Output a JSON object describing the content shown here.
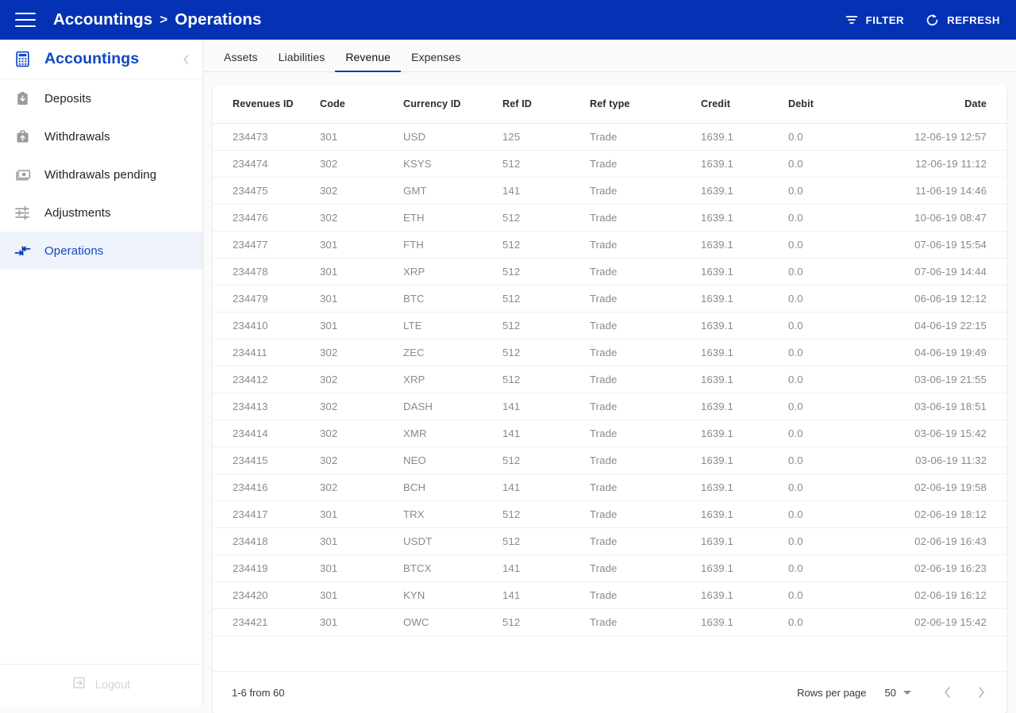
{
  "appbar": {
    "menu_icon": "hamburger-menu-icon",
    "breadcrumb_root": "Accountings",
    "breadcrumb_separator": ">",
    "breadcrumb_current": "Operations",
    "filter_label": "FILTER",
    "refresh_label": "REFRESH",
    "background_color": "#0531b4"
  },
  "sidebar": {
    "title": "Accountings",
    "title_icon": "calculator-icon",
    "collapse_icon": "chevron-left-icon",
    "accent_color": "#1047c4",
    "items": [
      {
        "label": "Deposits",
        "icon": "deposit-clipboard-down-icon",
        "active": false
      },
      {
        "label": "Withdrawals",
        "icon": "withdrawal-briefcase-up-icon",
        "active": false
      },
      {
        "label": "Withdrawals pending",
        "icon": "banknote-icon",
        "active": false
      },
      {
        "label": "Adjustments",
        "icon": "sliders-icon",
        "active": false
      },
      {
        "label": "Operations",
        "icon": "transfer-arrows-icon",
        "active": true
      }
    ],
    "logout_label": "Logout",
    "logout_icon": "logout-exit-icon"
  },
  "tabs": [
    {
      "label": "Assets",
      "active": false
    },
    {
      "label": "Liabilities",
      "active": false
    },
    {
      "label": "Revenue",
      "active": true
    },
    {
      "label": "Expenses",
      "active": false
    }
  ],
  "table": {
    "columns": [
      "Revenues ID",
      "Code",
      "Currency ID",
      "Ref ID",
      "Ref type",
      "Credit",
      "Debit",
      "Date"
    ],
    "rows": [
      [
        "234473",
        "301",
        "USD",
        "125",
        "Trade",
        "1639.1",
        "0.0",
        "12-06-19 12:57"
      ],
      [
        "234474",
        "302",
        "KSYS",
        "512",
        "Trade",
        "1639.1",
        "0.0",
        "12-06-19 11:12"
      ],
      [
        "234475",
        "302",
        "GMT",
        "141",
        "Trade",
        "1639.1",
        "0.0",
        "11-06-19 14:46"
      ],
      [
        "234476",
        "302",
        "ETH",
        "512",
        "Trade",
        "1639.1",
        "0.0",
        "10-06-19 08:47"
      ],
      [
        "234477",
        "301",
        "FTH",
        "512",
        "Trade",
        "1639.1",
        "0.0",
        "07-06-19 15:54"
      ],
      [
        "234478",
        "301",
        "XRP",
        "512",
        "Trade",
        "1639.1",
        "0.0",
        "07-06-19 14:44"
      ],
      [
        "234479",
        "301",
        "BTC",
        "512",
        "Trade",
        "1639.1",
        "0.0",
        "06-06-19 12:12"
      ],
      [
        "234410",
        "301",
        "LTE",
        "512",
        "Trade",
        "1639.1",
        "0.0",
        "04-06-19 22:15"
      ],
      [
        "234411",
        "302",
        "ZEC",
        "512",
        "Trade",
        "1639.1",
        "0.0",
        "04-06-19 19:49"
      ],
      [
        "234412",
        "302",
        "XRP",
        "512",
        "Trade",
        "1639.1",
        "0.0",
        "03-06-19 21:55"
      ],
      [
        "234413",
        "302",
        "DASH",
        "141",
        "Trade",
        "1639.1",
        "0.0",
        "03-06-19 18:51"
      ],
      [
        "234414",
        "302",
        "XMR",
        "141",
        "Trade",
        "1639.1",
        "0.0",
        "03-06-19 15:42"
      ],
      [
        "234415",
        "302",
        "NEO",
        "512",
        "Trade",
        "1639.1",
        "0.0",
        "03-06-19 11:32"
      ],
      [
        "234416",
        "302",
        "BCH",
        "141",
        "Trade",
        "1639.1",
        "0.0",
        "02-06-19 19:58"
      ],
      [
        "234417",
        "301",
        "TRX",
        "512",
        "Trade",
        "1639.1",
        "0.0",
        "02-06-19 18:12"
      ],
      [
        "234418",
        "301",
        "USDT",
        "512",
        "Trade",
        "1639.1",
        "0.0",
        "02-06-19 16:43"
      ],
      [
        "234419",
        "301",
        "BTCX",
        "141",
        "Trade",
        "1639.1",
        "0.0",
        "02-06-19 16:23"
      ],
      [
        "234420",
        "301",
        "KYN",
        "141",
        "Trade",
        "1639.1",
        "0.0",
        "02-06-19 16:12"
      ],
      [
        "234421",
        "301",
        "OWC",
        "512",
        "Trade",
        "1639.1",
        "0.0",
        "02-06-19 15:42"
      ]
    ]
  },
  "pagination": {
    "range_label": "1-6 from 60",
    "rows_per_page_label": "Rows per page",
    "rows_per_page_value": "50",
    "prev_icon": "chevron-left-icon",
    "next_icon": "chevron-right-icon"
  }
}
